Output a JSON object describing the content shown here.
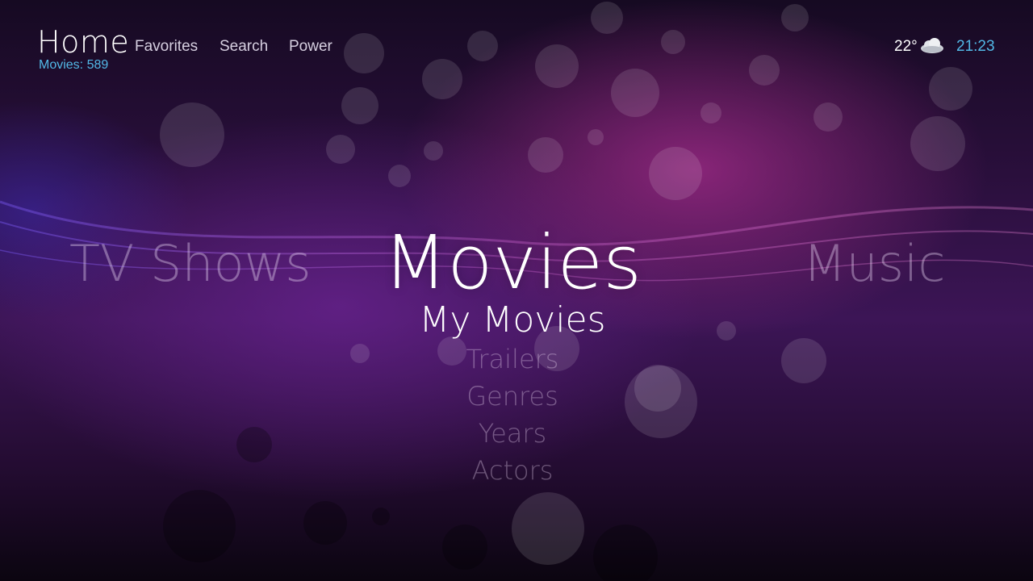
{
  "header": {
    "title": "Home",
    "subtitle": "Movies: 589",
    "nav": [
      "Favorites",
      "Search",
      "Power"
    ]
  },
  "status": {
    "temperature": "22°",
    "weather_icon": "cloud-icon",
    "time": "21:23"
  },
  "main_menu": {
    "previous": "TV Shows",
    "current": "Movies",
    "next": "Music",
    "submenu": [
      "My Movies",
      "Trailers",
      "Genres",
      "Years",
      "Actors"
    ],
    "submenu_selected_index": 0
  },
  "colors": {
    "accent": "#52b8e6",
    "background": "#3c1556"
  }
}
